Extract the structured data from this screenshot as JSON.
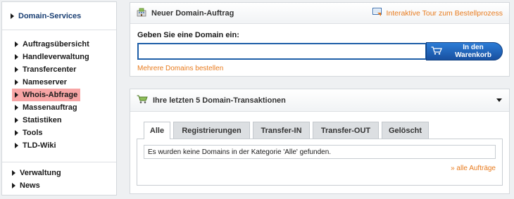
{
  "sidebar": {
    "header": "Domain-Services",
    "items": [
      {
        "label": "Auftragsübersicht",
        "active": false
      },
      {
        "label": "Handleverwaltung",
        "active": false
      },
      {
        "label": "Transfercenter",
        "active": false
      },
      {
        "label": "Nameserver",
        "active": false
      },
      {
        "label": "Whois-Abfrage",
        "active": true
      },
      {
        "label": "Massenauftrag",
        "active": false
      },
      {
        "label": "Statistiken",
        "active": false
      },
      {
        "label": "Tools",
        "active": false
      },
      {
        "label": "TLD-Wiki",
        "active": false
      }
    ],
    "bottom_items": [
      {
        "label": "Verwaltung"
      },
      {
        "label": "News"
      }
    ]
  },
  "new_order": {
    "title": "Neuer Domain-Auftrag",
    "tour_link": "Interaktive Tour zum Bestellprozess",
    "input_label": "Geben Sie eine Domain ein:",
    "input_value": "",
    "cart_button": "In den Warenkorb",
    "multi_link": "Mehrere Domains bestellen"
  },
  "transactions": {
    "title": "Ihre letzten 5 Domain-Transaktionen",
    "tabs": [
      {
        "label": "Alle",
        "active": true
      },
      {
        "label": "Registrierungen",
        "active": false
      },
      {
        "label": "Transfer-IN",
        "active": false
      },
      {
        "label": "Transfer-OUT",
        "active": false
      },
      {
        "label": "Gelöscht",
        "active": false
      }
    ],
    "empty_message": "Es wurden keine Domains in der Kategorie 'Alle' gefunden.",
    "all_orders_link": "» alle Aufträge"
  },
  "colors": {
    "accent_orange": "#e87b1e",
    "primary_blue": "#1f5fa8",
    "active_highlight": "#f7a5a5"
  }
}
